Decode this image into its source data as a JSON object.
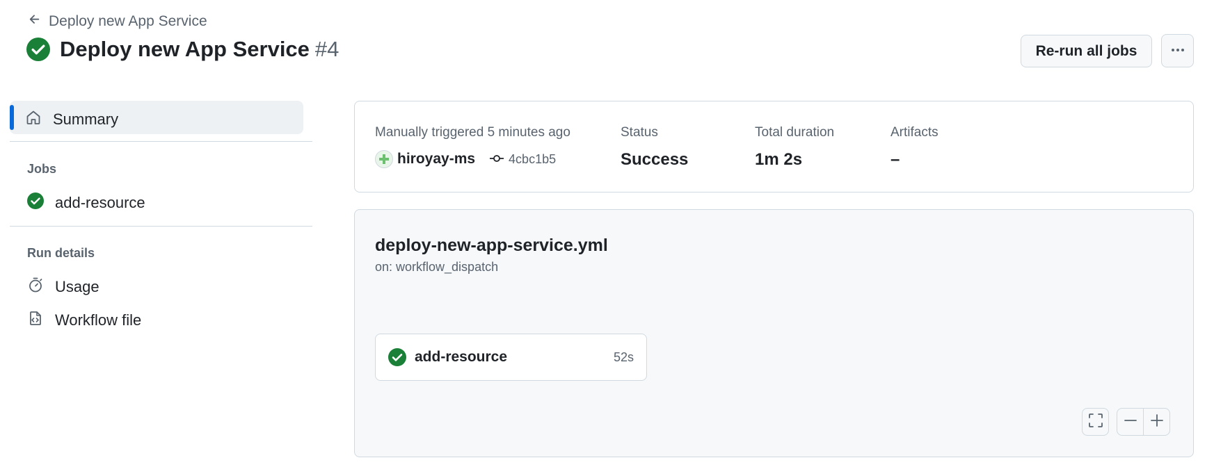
{
  "header": {
    "back_label": "Deploy new App Service",
    "title": "Deploy new App Service",
    "run_number": "#4",
    "rerun_label": "Re-run all jobs",
    "status": "success"
  },
  "sidebar": {
    "summary_label": "Summary",
    "jobs_heading": "Jobs",
    "jobs": [
      {
        "label": "add-resource",
        "status": "success"
      }
    ],
    "run_details_heading": "Run details",
    "run_details": [
      {
        "label": "Usage",
        "icon": "stopwatch-icon"
      },
      {
        "label": "Workflow file",
        "icon": "file-code-icon"
      }
    ]
  },
  "summary": {
    "trigger_label": "Manually triggered 5 minutes ago",
    "actor": "hiroyay-ms",
    "commit": "4cbc1b5",
    "status_label": "Status",
    "status_value": "Success",
    "duration_label": "Total duration",
    "duration_value": "1m 2s",
    "artifacts_label": "Artifacts",
    "artifacts_value": "–"
  },
  "graph": {
    "filename": "deploy-new-app-service.yml",
    "trigger": "on: workflow_dispatch",
    "jobs": [
      {
        "name": "add-resource",
        "duration": "52s",
        "status": "success"
      }
    ]
  },
  "colors": {
    "success": "#1a7f37",
    "accent": "#0969da",
    "muted_text": "#59636e"
  }
}
